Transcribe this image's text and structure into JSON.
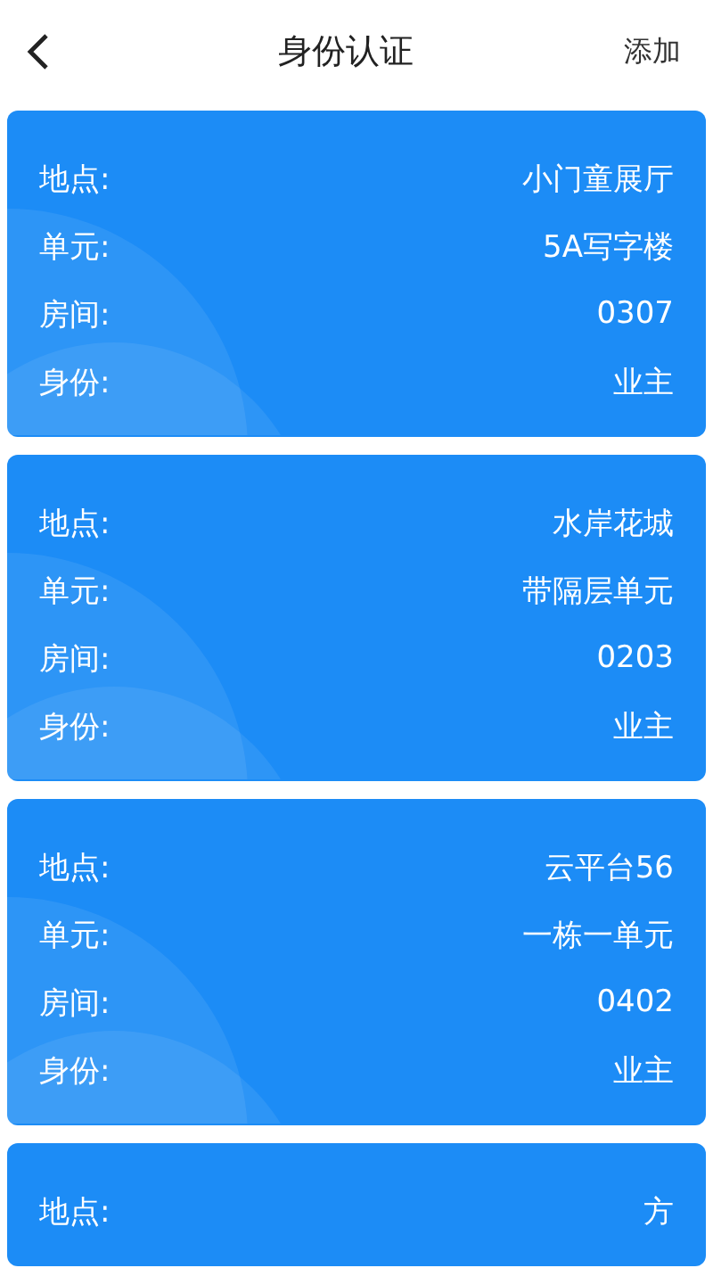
{
  "header": {
    "title": "身份认证",
    "action": "添加"
  },
  "cards": [
    {
      "rows": [
        {
          "label": "地点:",
          "value": "小门童展厅"
        },
        {
          "label": "单元:",
          "value": "5A写字楼"
        },
        {
          "label": "房间:",
          "value": "0307"
        },
        {
          "label": "身份:",
          "value": "业主"
        }
      ]
    },
    {
      "rows": [
        {
          "label": "地点:",
          "value": "水岸花城"
        },
        {
          "label": "单元:",
          "value": "带隔层单元"
        },
        {
          "label": "房间:",
          "value": "0203"
        },
        {
          "label": "身份:",
          "value": "业主"
        }
      ]
    },
    {
      "rows": [
        {
          "label": "地点:",
          "value": "云平台56"
        },
        {
          "label": "单元:",
          "value": "一栋一单元"
        },
        {
          "label": "房间:",
          "value": "0402"
        },
        {
          "label": "身份:",
          "value": "业主"
        }
      ]
    },
    {
      "rows": [
        {
          "label": "地点:",
          "value": "方"
        }
      ]
    }
  ]
}
